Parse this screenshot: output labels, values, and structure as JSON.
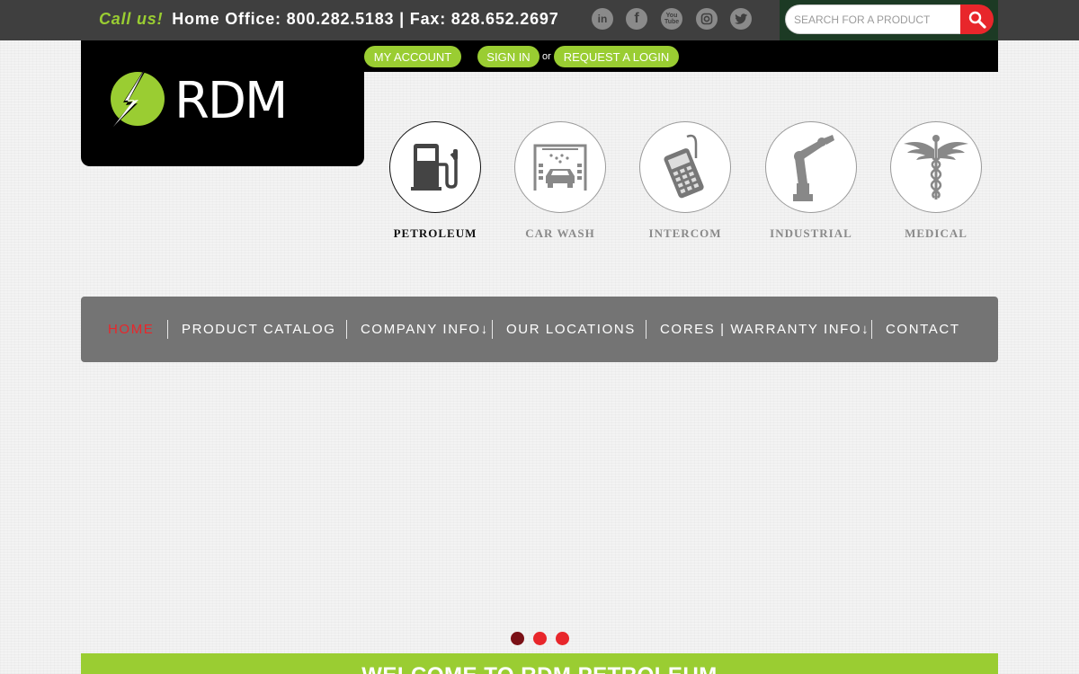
{
  "topbar": {
    "callus_label": "Call us!",
    "contact_line": "Home Office: 800.282.5183 | Fax: 828.652.2697",
    "social": [
      {
        "name": "linkedin-icon",
        "glyph": "in"
      },
      {
        "name": "facebook-icon",
        "glyph": "f"
      },
      {
        "name": "youtube-icon",
        "glyph": "You Tube"
      },
      {
        "name": "instagram-icon",
        "glyph": ""
      },
      {
        "name": "twitter-icon",
        "glyph": ""
      }
    ],
    "search": {
      "placeholder": "SEARCH FOR A PRODUCT",
      "value": "",
      "button_icon": "search-icon"
    }
  },
  "account": {
    "my_account": "MY ACCOUNT",
    "sign_in": "SIGN IN",
    "or": "or",
    "request_login": "REQUEST A LOGIN"
  },
  "logo": {
    "text": "RDM",
    "icon": "lightning-bolt-logo"
  },
  "categories": [
    {
      "label": "PETROLEUM",
      "icon": "fuel-pump-icon",
      "active": true
    },
    {
      "label": "CAR WASH",
      "icon": "car-wash-icon",
      "active": false
    },
    {
      "label": "INTERCOM",
      "icon": "card-terminal-icon",
      "active": false
    },
    {
      "label": "INDUSTRIAL",
      "icon": "robot-arm-icon",
      "active": false
    },
    {
      "label": "MEDICAL",
      "icon": "caduceus-icon",
      "active": false
    }
  ],
  "nav": {
    "items": [
      {
        "label": "HOME",
        "active": true
      },
      {
        "label": "PRODUCT CATALOG"
      },
      {
        "label": "COMPANY INFO↓"
      },
      {
        "label": "OUR LOCATIONS"
      },
      {
        "label": "CORES | WARRANTY INFO↓"
      },
      {
        "label": "CONTACT"
      }
    ]
  },
  "slider": {
    "slide_count": 3,
    "active_index": 0
  },
  "welcome": {
    "title": "WELCOME TO RDM PETROLEUM"
  },
  "colors": {
    "accent_green": "#9acd32",
    "accent_red": "#e8262b",
    "topbar_bg": "#3f3f3f",
    "nav_bg": "#747474"
  }
}
